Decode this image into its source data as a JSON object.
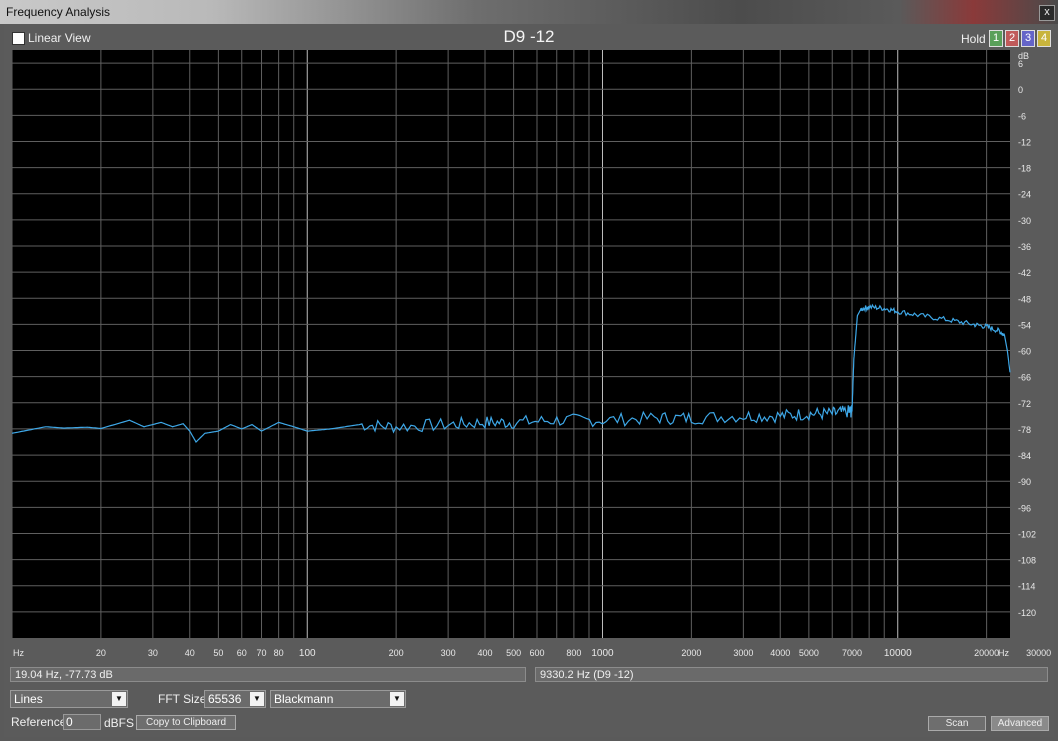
{
  "window": {
    "title": "Frequency Analysis",
    "close_label": "x"
  },
  "toolbar": {
    "linear_view_label": "Linear View",
    "linear_view_checked": false,
    "hold_label": "Hold",
    "hold_buttons": [
      {
        "label": "1",
        "color": "#5aa05a"
      },
      {
        "label": "2",
        "color": "#c05a5a"
      },
      {
        "label": "3",
        "color": "#6464c8"
      },
      {
        "label": "4",
        "color": "#c8b43c"
      }
    ]
  },
  "chart_data": {
    "type": "line",
    "title": "D9 -12",
    "x_scale": "log",
    "xlim": [
      10,
      24000
    ],
    "ylim": [
      -126,
      9
    ],
    "x_unit_label": "Hz",
    "y_unit_label": "dB",
    "x_ticks": [
      {
        "v": 20,
        "t": "20"
      },
      {
        "v": 30,
        "t": "30"
      },
      {
        "v": 40,
        "t": "40"
      },
      {
        "v": 50,
        "t": "50"
      },
      {
        "v": 60,
        "t": "60"
      },
      {
        "v": 70,
        "t": "70"
      },
      {
        "v": 80,
        "t": "80"
      },
      {
        "v": 100,
        "t": "100"
      },
      {
        "v": 200,
        "t": "200"
      },
      {
        "v": 300,
        "t": "300"
      },
      {
        "v": 400,
        "t": "400"
      },
      {
        "v": 500,
        "t": "500"
      },
      {
        "v": 600,
        "t": "600"
      },
      {
        "v": 800,
        "t": "800"
      },
      {
        "v": 1000,
        "t": "1000"
      },
      {
        "v": 2000,
        "t": "2000"
      },
      {
        "v": 3000,
        "t": "3000"
      },
      {
        "v": 4000,
        "t": "4000"
      },
      {
        "v": 5000,
        "t": "5000"
      },
      {
        "v": 7000,
        "t": "7000"
      },
      {
        "v": 10000,
        "t": "10000"
      },
      {
        "v": 20000,
        "t": "20000"
      },
      {
        "v": 30000,
        "t": "30000"
      }
    ],
    "y_ticks": [
      6,
      0,
      -6,
      -12,
      -18,
      -24,
      -30,
      -36,
      -42,
      -48,
      -54,
      -60,
      -66,
      -72,
      -78,
      -84,
      -90,
      -96,
      -102,
      -108,
      -114,
      -120
    ],
    "series": [
      {
        "color": "#3ea8e8",
        "points": [
          [
            10,
            -79
          ],
          [
            13,
            -77.5
          ],
          [
            15,
            -77.8
          ],
          [
            18,
            -77.6
          ],
          [
            20,
            -77.9
          ],
          [
            25,
            -76
          ],
          [
            28,
            -77.5
          ],
          [
            32,
            -76.5
          ],
          [
            35,
            -77.5
          ],
          [
            38,
            -76.8
          ],
          [
            40,
            -78.5
          ],
          [
            42,
            -81
          ],
          [
            45,
            -79
          ],
          [
            50,
            -78.5
          ],
          [
            55,
            -77
          ],
          [
            60,
            -78
          ],
          [
            65,
            -77
          ],
          [
            70,
            -78.5
          ],
          [
            80,
            -76.5
          ],
          [
            90,
            -77.5
          ],
          [
            100,
            -78.5
          ],
          [
            120,
            -78
          ],
          [
            150,
            -77
          ],
          [
            200,
            -77.5
          ],
          [
            300,
            -77
          ],
          [
            400,
            -76.5
          ],
          [
            500,
            -76.5
          ],
          [
            700,
            -76
          ],
          [
            1000,
            -76
          ],
          [
            1500,
            -75.5
          ],
          [
            2000,
            -75.5
          ],
          [
            3000,
            -75
          ],
          [
            4000,
            -75
          ],
          [
            5000,
            -74.5
          ],
          [
            6000,
            -74.5
          ],
          [
            6800,
            -74
          ],
          [
            7000,
            -74
          ],
          [
            7100,
            -62
          ],
          [
            7300,
            -52
          ],
          [
            7500,
            -50.5
          ],
          [
            8000,
            -50
          ],
          [
            9000,
            -50.3
          ],
          [
            10000,
            -51
          ],
          [
            12000,
            -52
          ],
          [
            15000,
            -53
          ],
          [
            18000,
            -54
          ],
          [
            20000,
            -54.5
          ],
          [
            22000,
            -55.5
          ],
          [
            23000,
            -56.5
          ],
          [
            23500,
            -60
          ],
          [
            24000,
            -65
          ]
        ]
      }
    ]
  },
  "status": {
    "left": "19.04 Hz, -77.73 dB",
    "right": "9330.2 Hz (D9 -12)"
  },
  "controls": {
    "mode": "Lines",
    "fft_label": "FFT Size",
    "fft_size": "65536",
    "window_func": "Blackmann",
    "reference_label": "Reference",
    "reference_value": "0",
    "reference_unit": "dBFS",
    "copy_label": "Copy to Clipboard",
    "scan_label": "Scan",
    "advanced_label": "Advanced"
  }
}
